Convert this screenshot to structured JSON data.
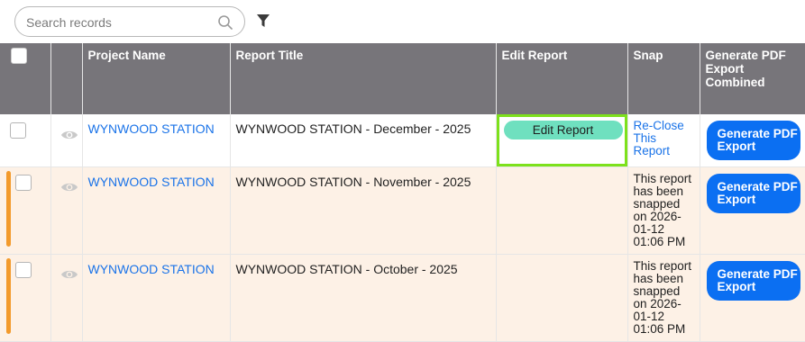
{
  "search": {
    "placeholder": "Search records",
    "value": ""
  },
  "columns": {
    "project_name": "Project Name",
    "report_title": "Report Title",
    "edit_report": "Edit Report",
    "snap": "Snap",
    "generate_pdf": "Generate PDF Export Combined"
  },
  "rows": [
    {
      "project": "WYNWOOD STATION",
      "title": "WYNWOOD STATION - December - 2025",
      "edit_label": "Edit Report",
      "snap": "Re-Close This Report",
      "pdf_label": "Generate PDF Export"
    },
    {
      "project": "WYNWOOD STATION",
      "title": "WYNWOOD STATION - November - 2025",
      "snap": "This report has been snapped on 2026-01-12 01:06 PM",
      "pdf_label": "Generate PDF Export"
    },
    {
      "project": "WYNWOOD STATION",
      "title": "WYNWOOD STATION - October - 2025",
      "snap": "This report has been snapped on 2026-01-12 01:06 PM",
      "pdf_label": "Generate PDF Export"
    }
  ],
  "colors": {
    "header_bg": "#77757a",
    "link": "#1a73e8",
    "edit_button": "#6fe0bf",
    "edit_highlight": "#7de11c",
    "pdf_button": "#0b6ff2",
    "row_marker": "#f39a2b",
    "row_peach": "#fdf1e6"
  },
  "icons": [
    "search-icon",
    "filter-icon",
    "eye-icon"
  ]
}
